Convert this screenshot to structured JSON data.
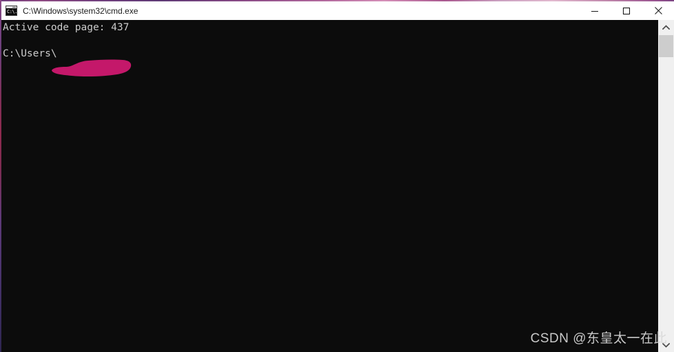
{
  "window": {
    "title": "C:\\Windows\\system32\\cmd.exe",
    "icon": "cmd-console-icon",
    "icon_glyph": "C:\\.",
    "titlebar_bg": "#ffffff",
    "titlebar_fg": "#1a1a1a",
    "controls": [
      {
        "name": "minimize",
        "label": "Minimize",
        "glyph": "—"
      },
      {
        "name": "maximize",
        "label": "Maximize",
        "glyph": "□"
      },
      {
        "name": "close",
        "label": "Close",
        "glyph": "✕"
      }
    ]
  },
  "console": {
    "background": "#0c0c0c",
    "foreground": "#cccccc",
    "lines": [
      "Active code page: 437",
      "",
      "C:\\Users\\"
    ],
    "text": "Active code page: 437\n\nC:\\Users\\",
    "redaction": {
      "name": "redaction-stroke",
      "color": "#c4186a",
      "note": "hand-drawn magenta mark covering the username"
    }
  },
  "scrollbar": {
    "up_arrow": "⌃",
    "down_arrow": "⌄",
    "track_color": "#f0f0f0",
    "thumb_color": "#cdcdcd",
    "position_percent": 5
  },
  "watermark": {
    "text": "CSDN @东皇太一在此",
    "color": "#d8d8d8"
  },
  "desktop": {
    "wallpaper_note": "pink-purple gradient visible at window edges"
  }
}
